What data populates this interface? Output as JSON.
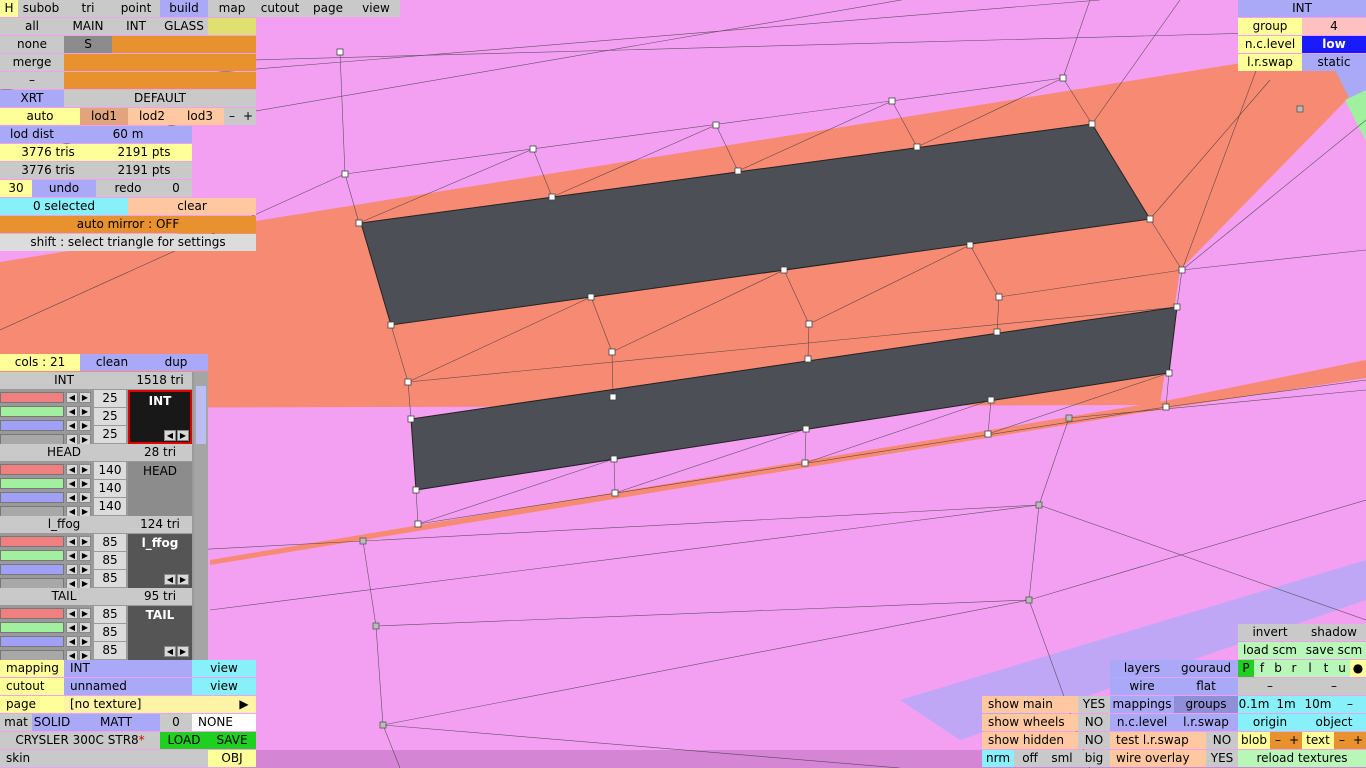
{
  "top_tabs": [
    "H",
    "subob",
    "tri",
    "point",
    "build",
    "map",
    "cutout",
    "page",
    "view"
  ],
  "subob_panel": {
    "row1": [
      "all",
      "MAIN",
      "INT",
      "GLASS"
    ],
    "row2": [
      "none",
      "S"
    ],
    "row3": [
      "merge"
    ],
    "row4": [
      "–"
    ]
  },
  "xrt": {
    "label": "XRT",
    "value": "DEFAULT"
  },
  "lod": {
    "items": [
      "auto",
      "lod1",
      "lod2",
      "lod3"
    ],
    "minus": "–",
    "plus": "+"
  },
  "lod_dist": {
    "label": "lod dist",
    "value": "60 m"
  },
  "stats": {
    "tris1": "3776 tris",
    "pts1": "2191 pts",
    "tris2": "3776 tris",
    "pts2": "2191 pts"
  },
  "undo_row": {
    "count": "30",
    "undo": "undo",
    "redo": "redo",
    "redo_count": "0"
  },
  "selection": {
    "selected": "0 selected",
    "clear": "clear"
  },
  "auto_mirror": "auto mirror : OFF",
  "hint": "shift : select triangle for settings",
  "top_right": {
    "title": "INT",
    "group_label": "group",
    "group_value": "4",
    "nc_label": "n.c.level",
    "nc_value": "low",
    "lr_label": "l.r.swap",
    "lr_value": "static"
  },
  "cols": {
    "label": "cols : 21",
    "clean": "clean",
    "dup": "dup"
  },
  "color_groups": [
    {
      "name": "INT",
      "tri": "1518 tri",
      "values": [
        "25",
        "25",
        "25"
      ],
      "preview": "INT"
    },
    {
      "name": "HEAD",
      "tri": "28 tri",
      "values": [
        "140",
        "140",
        "140"
      ],
      "preview": "HEAD"
    },
    {
      "name": "l_ffog",
      "tri": "124 tri",
      "values": [
        "85",
        "85",
        "85"
      ],
      "preview": "l_ffog"
    },
    {
      "name": "TAIL",
      "tri": "95 tri",
      "values": [
        "85",
        "85",
        "85"
      ],
      "preview": "TAIL"
    }
  ],
  "bottom_left": {
    "mapping_label": "mapping",
    "mapping_value": "INT",
    "mapping_view": "view",
    "cutout_label": "cutout",
    "cutout_value": "unnamed",
    "cutout_view": "view",
    "page_label": "page",
    "page_value": "[no texture]",
    "page_arrow": "▶",
    "mat": "mat",
    "solid": "SOLID",
    "matt": "MATT",
    "zero": "0",
    "none": "NONE",
    "car_name": "CRYSLER 300C STR8",
    "car_flag": "*",
    "load": "LOAD",
    "save": "SAVE",
    "skin": "skin",
    "obj": "OBJ"
  },
  "bottom_mid": {
    "show_main": "show main",
    "show_main_v": "YES",
    "show_wheels": "show wheels",
    "show_wheels_v": "NO",
    "show_hidden": "show hidden",
    "show_hidden_v": "NO",
    "nrm": "nrm",
    "off": "off",
    "sml": "sml",
    "big": "big"
  },
  "bottom_right": {
    "invert": "invert",
    "shadow": "shadow",
    "load_scm": "load scm",
    "save_scm": "save scm",
    "layers": "layers",
    "gouraud": "gouraud",
    "pfbrltu": [
      "P",
      "f",
      "b",
      "r",
      "l",
      "t",
      "u",
      "●"
    ],
    "wire": "wire",
    "flat": "flat",
    "dash1": "–",
    "dash2": "–",
    "mappings": "mappings",
    "groups": "groups",
    "m01": "0.1m",
    "m1": "1m",
    "m10": "10m",
    "mminus": "–",
    "nclevel": "n.c.level",
    "lrswap": "l.r.swap",
    "origin": "origin",
    "object": "object",
    "test_lr": "test l.r.swap",
    "test_lr_v": "NO",
    "blob": "blob",
    "text": "text",
    "pm_minus": "–",
    "pm_plus": "+",
    "wire_overlay": "wire overlay",
    "wire_overlay_v": "YES",
    "reload": "reload textures"
  },
  "colors": {
    "viewport": "#f3a0f3",
    "body": "#f78a72",
    "dark_panel": "#4d4f56",
    "accent": "#a9a9f7"
  }
}
